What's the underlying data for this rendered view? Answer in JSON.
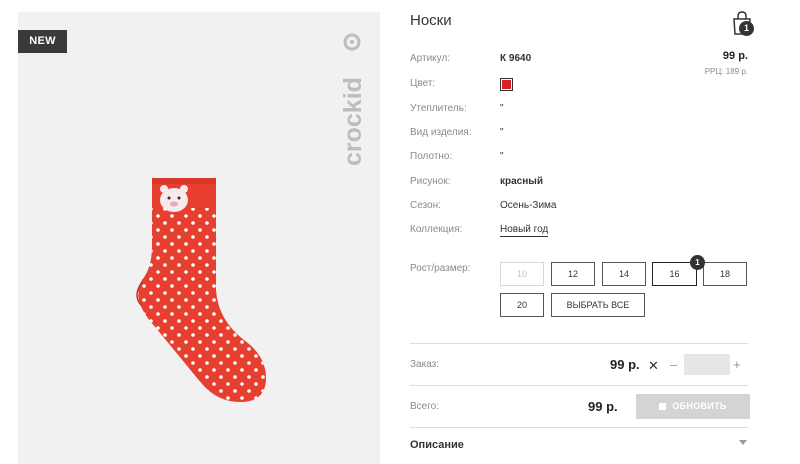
{
  "product": {
    "title": "Носки",
    "badge": "NEW",
    "brand": "crockid",
    "price": "99 р.",
    "rrp": "РРЦ: 189 р.",
    "color_hex": "#d62027"
  },
  "cart": {
    "count": "1"
  },
  "attributes": {
    "article_label": "Артикул:",
    "article_value": "К 9640",
    "color_label": "Цвет:",
    "insulation_label": "Утеплитель:",
    "insulation_value": "\"",
    "type_label": "Вид изделия:",
    "type_value": "\"",
    "fabric_label": "Полотно:",
    "fabric_value": "\"",
    "pattern_label": "Рисунок:",
    "pattern_value": "красный",
    "season_label": "Сезон:",
    "season_value": "Осень-Зима",
    "collection_label": "Коллекция:",
    "collection_value": "Новый год"
  },
  "sizes": {
    "label": "Рост/размер:",
    "items": [
      "10",
      "12",
      "14",
      "16",
      "18",
      "20"
    ],
    "select_all": "ВЫБРАТЬ ВСЕ",
    "selected_count": "1"
  },
  "order": {
    "label": "Заказ:",
    "price": "99 р.",
    "times": "✕",
    "minus": "–",
    "plus": "+",
    "quantity": ""
  },
  "total": {
    "label": "Всего:",
    "price": "99 р.",
    "update": "ОБНОВИТЬ"
  },
  "description": {
    "title": "Описание"
  }
}
